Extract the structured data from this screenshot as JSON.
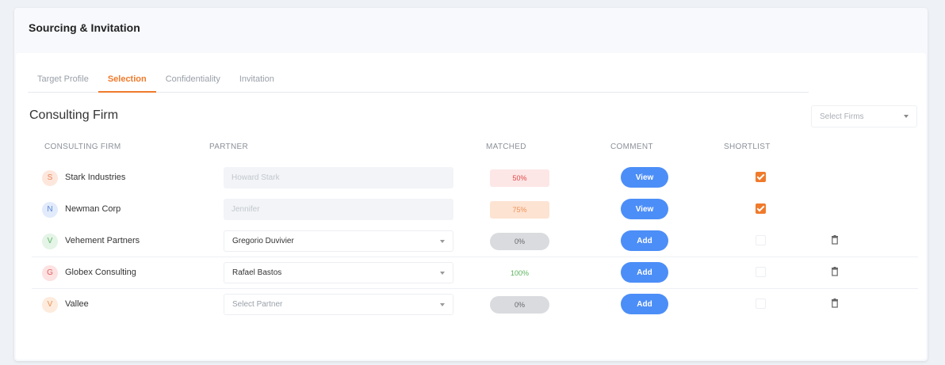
{
  "header": {
    "title": "Sourcing & Invitation"
  },
  "tabs": [
    {
      "label": "Target Profile",
      "active": false
    },
    {
      "label": "Selection",
      "active": true
    },
    {
      "label": "Confidentiality",
      "active": false
    },
    {
      "label": "Invitation",
      "active": false
    }
  ],
  "section": {
    "title": "Consulting Firm",
    "firm_select_placeholder": "Select Firms"
  },
  "columns": {
    "firm": "CONSULTING FIRM",
    "partner": "PARTNER",
    "matched": "MATCHED",
    "comment": "COMMENT",
    "shortlist": "SHORTLIST"
  },
  "rows": [
    {
      "initial": "S",
      "firm": "Stark Industries",
      "partner": "Howard Stark",
      "partner_mode": "readonly",
      "matched": "50%",
      "matched_style": "red",
      "comment_button": "View",
      "shortlisted": true,
      "deletable": false
    },
    {
      "initial": "N",
      "firm": "Newman Corp",
      "partner": "Jennifer",
      "partner_mode": "readonly",
      "matched": "75%",
      "matched_style": "orange",
      "comment_button": "View",
      "shortlisted": true,
      "deletable": false
    },
    {
      "initial": "V",
      "firm": "Vehement Partners",
      "partner": "Gregorio Duvivier",
      "partner_mode": "select",
      "matched": "0%",
      "matched_style": "grey",
      "comment_button": "Add",
      "shortlisted": false,
      "deletable": true
    },
    {
      "initial": "G",
      "firm": "Globex Consulting",
      "partner": "Rafael Bastos",
      "partner_mode": "select",
      "matched": "100%",
      "matched_style": "green",
      "comment_button": "Add",
      "shortlisted": false,
      "deletable": true
    },
    {
      "initial": "V",
      "firm": "Vallee",
      "partner": "Select Partner",
      "partner_mode": "placeholder",
      "matched": "0%",
      "matched_style": "grey",
      "comment_button": "Add",
      "shortlisted": false,
      "deletable": true
    }
  ],
  "colors": {
    "accent": "#f07a2b",
    "button": "#4c8ef7",
    "avatars": [
      "#fde7dc",
      "#e2ebfb",
      "#e4f4e6",
      "#fde2e2",
      "#fdebdd"
    ],
    "avatar_text": [
      "#e8835a",
      "#5b86d6",
      "#5fb36c",
      "#e06060",
      "#e8935a"
    ],
    "matched": {
      "red": {
        "bg": "#fde6e6",
        "fg": "#e04848"
      },
      "orange": {
        "bg": "#fde3d2",
        "fg": "#ee9358"
      },
      "grey": {
        "bg": "#d9dbdf",
        "fg": "#666"
      },
      "green": {
        "bg": "#ffffff",
        "fg": "#5ab35a"
      }
    }
  },
  "icons": {
    "delete": "trash-icon",
    "dropdown": "chevron-down-icon"
  }
}
